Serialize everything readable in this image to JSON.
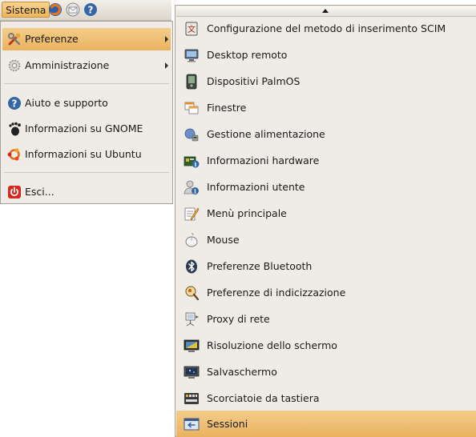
{
  "panel": {
    "menu_label": "Sistema",
    "launchers": [
      "firefox-icon",
      "mail-icon",
      "help-icon"
    ]
  },
  "main_menu": {
    "items": [
      {
        "label": "Preferenze",
        "icon": "preferences-tools-icon",
        "submenu": true,
        "active": true
      },
      {
        "label": "Amministrazione",
        "icon": "administration-gear-icon",
        "submenu": true,
        "active": false
      },
      {
        "label": "Aiuto e supporto",
        "icon": "help-icon",
        "submenu": false,
        "active": false
      },
      {
        "label": "Informazioni su GNOME",
        "icon": "gnome-foot-icon",
        "submenu": false,
        "active": false
      },
      {
        "label": "Informazioni su Ubuntu",
        "icon": "ubuntu-logo-icon",
        "submenu": false,
        "active": false
      },
      {
        "label": "Esci...",
        "icon": "power-icon",
        "submenu": false,
        "active": false
      }
    ]
  },
  "submenu": {
    "items": [
      {
        "label": "Configurazione del metodo di inserimento SCIM",
        "icon": "scim-input-icon"
      },
      {
        "label": "Desktop remoto",
        "icon": "remote-desktop-icon"
      },
      {
        "label": "Dispositivi PalmOS",
        "icon": "palm-device-icon"
      },
      {
        "label": "Finestre",
        "icon": "windows-icon"
      },
      {
        "label": "Gestione alimentazione",
        "icon": "power-management-icon"
      },
      {
        "label": "Informazioni hardware",
        "icon": "hardware-info-icon"
      },
      {
        "label": "Informazioni utente",
        "icon": "user-info-icon"
      },
      {
        "label": "Menù principale",
        "icon": "main-menu-editor-icon"
      },
      {
        "label": "Mouse",
        "icon": "mouse-icon"
      },
      {
        "label": "Preferenze Bluetooth",
        "icon": "bluetooth-icon"
      },
      {
        "label": "Preferenze di indicizzazione",
        "icon": "indexing-search-icon"
      },
      {
        "label": "Proxy di rete",
        "icon": "network-proxy-icon"
      },
      {
        "label": "Risoluzione dello schermo",
        "icon": "screen-resolution-icon"
      },
      {
        "label": "Salvaschermo",
        "icon": "screensaver-icon"
      },
      {
        "label": "Scorciatoie da tastiera",
        "icon": "keyboard-shortcuts-icon"
      },
      {
        "label": "Sessioni",
        "icon": "sessions-icon",
        "active": true
      }
    ]
  },
  "colors": {
    "highlight": "#eeb65a",
    "menu_bg": "#efebe7",
    "border": "#a9a39a"
  }
}
